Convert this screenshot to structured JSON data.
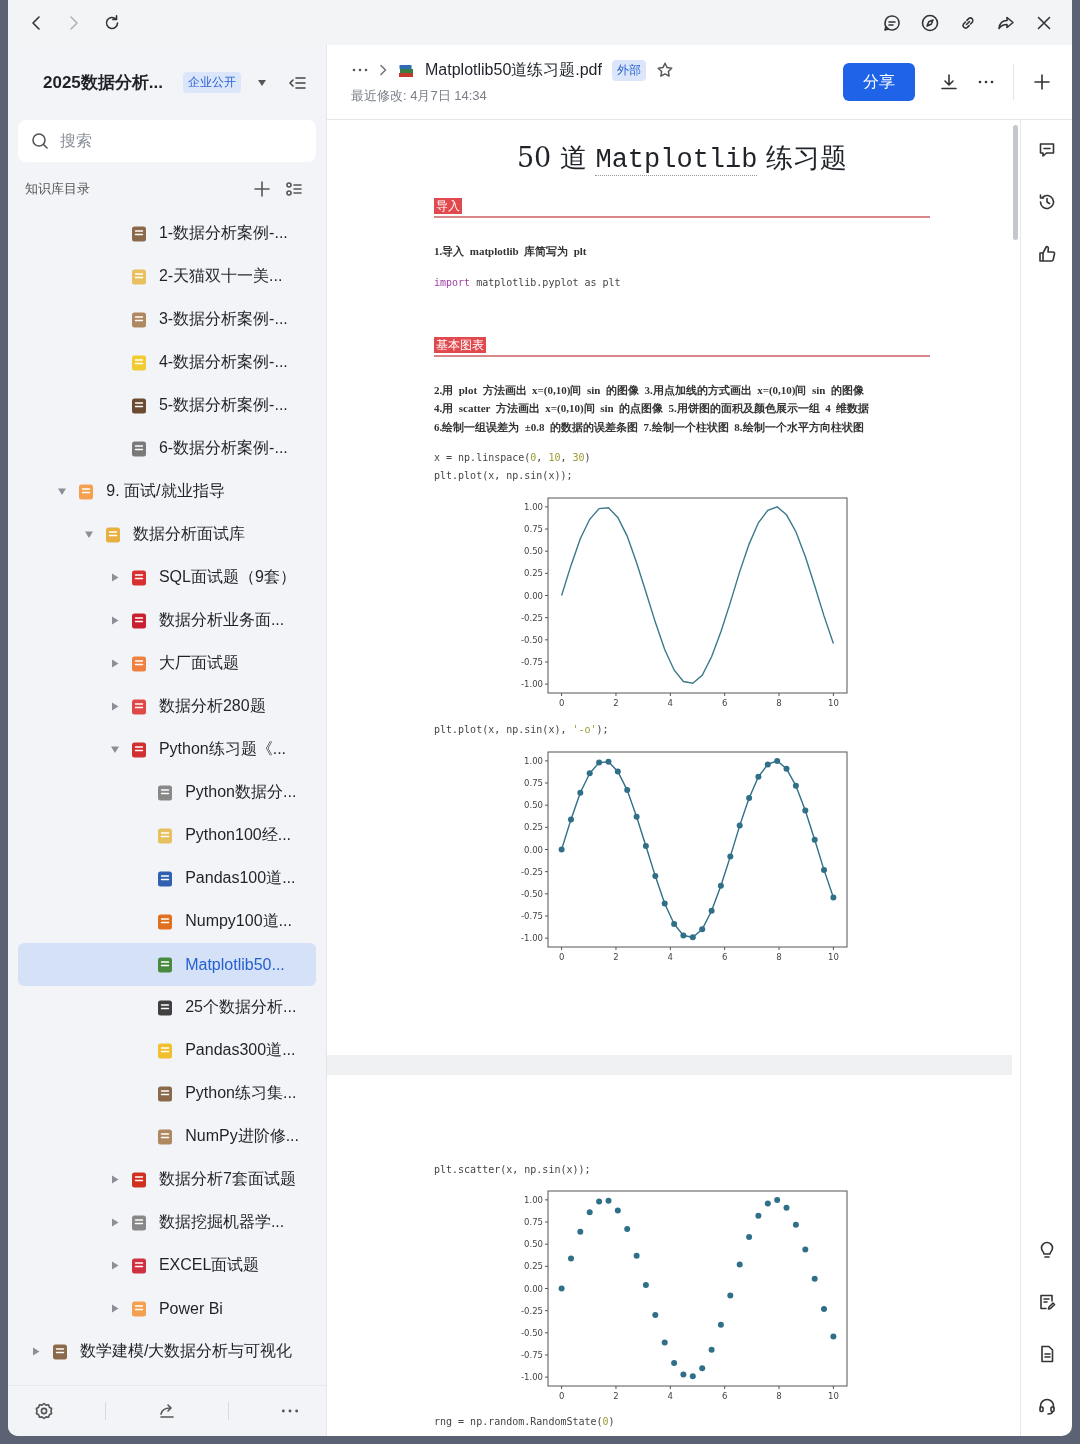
{
  "browser_bar": {
    "nav_buttons": [
      {
        "kind": "back",
        "disabled": false
      },
      {
        "kind": "forward",
        "disabled": true
      },
      {
        "kind": "reload",
        "disabled": false
      }
    ]
  },
  "sidebar": {
    "title": "2025数据分析...",
    "badge": "企业公开",
    "search": {
      "placeholder": "搜索"
    },
    "section_label": "知识库目录",
    "tree": [
      {
        "children": [
          {
            "children": [
              {
                "children": [
                  {
                    "label": "1-数据分析案例-...",
                    "selected": false,
                    "color": "#8a6a4a"
                  },
                  {
                    "label": "2-天猫双十一美...",
                    "selected": false,
                    "color": "#e8c060"
                  },
                  {
                    "label": "3-数据分析案例-...",
                    "selected": false,
                    "color": "#b08860"
                  },
                  {
                    "label": "4-数据分析案例-...",
                    "selected": false,
                    "color": "#f0cc30"
                  },
                  {
                    "label": "5-数据分析案例-...",
                    "selected": false,
                    "color": "#6a4a30"
                  },
                  {
                    "label": "6-数据分析案例-...",
                    "selected": false,
                    "color": "#7a7a7a"
                  }
                ]
              }
            ]
          },
          {
            "label": "9. 面试/就业指导",
            "selected": false,
            "expanded": true,
            "color": "#f5a050",
            "children": [
              {
                "label": "数据分析面试库",
                "selected": false,
                "expanded": true,
                "color": "#e8b040",
                "children": [
                  {
                    "label": "SQL面试题（9套）",
                    "selected": false,
                    "expanded": false,
                    "color": "#d83030"
                  },
                  {
                    "label": "数据分析业务面...",
                    "selected": false,
                    "expanded": false,
                    "color": "#c82030"
                  },
                  {
                    "label": "大厂面试题",
                    "selected": false,
                    "expanded": false,
                    "color": "#f08040"
                  },
                  {
                    "label": "数据分析280题",
                    "selected": false,
                    "expanded": false,
                    "color": "#e04848"
                  },
                  {
                    "label": "Python练习题《...",
                    "selected": false,
                    "expanded": true,
                    "color": "#d03030",
                    "children": [
                      {
                        "label": "Python数据分...",
                        "selected": false,
                        "color": "#888888"
                      },
                      {
                        "label": "Python100经...",
                        "selected": false,
                        "color": "#e8c060"
                      },
                      {
                        "label": "Pandas100道...",
                        "selected": false,
                        "color": "#3060b0"
                      },
                      {
                        "label": "Numpy100道...",
                        "selected": false,
                        "color": "#e07020"
                      },
                      {
                        "label": "Matplotlib50...",
                        "selected": true,
                        "color": "#4a8a40"
                      },
                      {
                        "label": "25个数据分析...",
                        "selected": false,
                        "color": "#404040"
                      },
                      {
                        "label": "Pandas300道...",
                        "selected": false,
                        "color": "#f0c030"
                      },
                      {
                        "label": "Python练习集...",
                        "selected": false,
                        "color": "#8a6a4a"
                      },
                      {
                        "label": "NumPy进阶修...",
                        "selected": false,
                        "color": "#b08860"
                      }
                    ]
                  },
                  {
                    "label": "数据分析7套面试题",
                    "selected": false,
                    "expanded": false,
                    "color": "#d03020"
                  },
                  {
                    "label": "数据挖掘机器学...",
                    "selected": false,
                    "expanded": false,
                    "color": "#888888"
                  },
                  {
                    "label": "EXCEL面试题",
                    "selected": false,
                    "expanded": false,
                    "color": "#d03040"
                  },
                  {
                    "label": "Power Bi",
                    "selected": false,
                    "expanded": false,
                    "color": "#f5a050"
                  }
                ]
              }
            ]
          }
        ]
      },
      {
        "label": "数学建模/大数据分析与可视化",
        "selected": false,
        "expanded": false,
        "color": "#8a6a4a"
      }
    ]
  },
  "document_header": {
    "file_name": "Matplotlib50道练习题.pdf",
    "badge": "外部",
    "modified": "最近修改: 4月7日 14:34",
    "share_button": "分享"
  },
  "document": {
    "pages": [
      {
        "blocks": [
          {
            "kind": "title",
            "segments": [
              {
                "text": "50 道 ",
                "kind": "plain"
              },
              {
                "text": "Matplotlib",
                "kind": "code"
              },
              {
                "text": " 练习题",
                "kind": "plain"
              }
            ]
          },
          {
            "kind": "section",
            "label": "导入"
          },
          {
            "kind": "text",
            "lines": [
              "1.导入  matplotlib  库简写为  plt"
            ]
          },
          {
            "kind": "code",
            "lines": [
              [
                {
                  "text": "import",
                  "kind": "keyword"
                },
                {
                  "text": " matplotlib.pyplot as plt",
                  "kind": "plain"
                }
              ]
            ]
          },
          {
            "kind": "section",
            "label": "基本图表"
          },
          {
            "kind": "text",
            "lines": [
              "2.用  plot  方法画出  x=(0,10)间  sin  的图像  3.用点加线的方式画出  x=(0,10)间  sin  的图像",
              "4.用  scatter  方法画出  x=(0,10)间  sin  的点图像  5.用饼图的面积及颜色展示一组  4  维数据",
              "6.绘制一组误差为  ±0.8  的数据的误差条图  7.绘制一个柱状图  8.绘制一个水平方向柱状图"
            ]
          },
          {
            "kind": "code",
            "lines": [
              [
                {
                  "text": "x = np.linspace(",
                  "kind": "plain"
                },
                {
                  "text": "0",
                  "kind": "number"
                },
                {
                  "text": ", ",
                  "kind": "plain"
                },
                {
                  "text": "10",
                  "kind": "number"
                },
                {
                  "text": ", ",
                  "kind": "plain"
                },
                {
                  "text": "30",
                  "kind": "number"
                },
                {
                  "text": ")",
                  "kind": "plain"
                }
              ],
              [
                {
                  "text": "plt.plot(x, np.sin(x));",
                  "kind": "plain"
                }
              ]
            ]
          },
          {
            "kind": "chart",
            "chart_data": {
              "type": "line",
              "x": [
                0,
                0.345,
                0.69,
                1.034,
                1.379,
                1.724,
                2.069,
                2.414,
                2.759,
                3.103,
                3.448,
                3.793,
                4.138,
                4.483,
                4.828,
                5.172,
                5.517,
                5.862,
                6.207,
                6.552,
                6.897,
                7.241,
                7.586,
                7.931,
                8.276,
                8.621,
                8.966,
                9.31,
                9.655,
                10
              ],
              "series": [
                {
                  "color": "#3a7a8c",
                  "values": [
                    0,
                    0.34,
                    0.64,
                    0.86,
                    0.98,
                    0.99,
                    0.88,
                    0.67,
                    0.37,
                    0.04,
                    -0.3,
                    -0.61,
                    -0.84,
                    -0.97,
                    -0.99,
                    -0.9,
                    -0.69,
                    -0.41,
                    -0.08,
                    0.27,
                    0.58,
                    0.82,
                    0.96,
                    1,
                    0.91,
                    0.72,
                    0.44,
                    0.11,
                    -0.23,
                    -0.54
                  ]
                }
              ],
              "xlim": [
                -0.5,
                10.5
              ],
              "ylim": [
                -1.1,
                1.1
              ],
              "xticks": [
                0,
                2,
                4,
                6,
                8,
                10
              ],
              "yticks": [
                {
                  "value": 1,
                  "label": "1.00"
                },
                {
                  "value": 0.75,
                  "label": "0.75"
                },
                {
                  "value": 0.5,
                  "label": "0.50"
                },
                {
                  "value": 0.25,
                  "label": "0.25"
                },
                {
                  "value": 0,
                  "label": "0.00"
                },
                {
                  "value": -0.25,
                  "label": "-0.25"
                },
                {
                  "value": -0.5,
                  "label": "-0.50"
                },
                {
                  "value": -0.75,
                  "label": "-0.75"
                },
                {
                  "value": -1,
                  "label": "-1.00"
                }
              ]
            }
          },
          {
            "kind": "code",
            "lines": [
              [
                {
                  "text": "plt.plot(x, np.sin(x), ",
                  "kind": "plain"
                },
                {
                  "text": "'-o'",
                  "kind": "string"
                },
                {
                  "text": ");",
                  "kind": "plain"
                }
              ]
            ]
          },
          {
            "kind": "chart",
            "chart_data": {
              "type": "line",
              "x": [
                0,
                0.345,
                0.69,
                1.034,
                1.379,
                1.724,
                2.069,
                2.414,
                2.759,
                3.103,
                3.448,
                3.793,
                4.138,
                4.483,
                4.828,
                5.172,
                5.517,
                5.862,
                6.207,
                6.552,
                6.897,
                7.241,
                7.586,
                7.931,
                8.276,
                8.621,
                8.966,
                9.31,
                9.655,
                10
              ],
              "series": [
                {
                  "color": "#2f6f88",
                  "marker": "o",
                  "values": [
                    0,
                    0.34,
                    0.64,
                    0.86,
                    0.98,
                    0.99,
                    0.88,
                    0.67,
                    0.37,
                    0.04,
                    -0.3,
                    -0.61,
                    -0.84,
                    -0.97,
                    -0.99,
                    -0.9,
                    -0.69,
                    -0.41,
                    -0.08,
                    0.27,
                    0.58,
                    0.82,
                    0.96,
                    1,
                    0.91,
                    0.72,
                    0.44,
                    0.11,
                    -0.23,
                    -0.54
                  ]
                }
              ],
              "xlim": [
                -0.5,
                10.5
              ],
              "ylim": [
                -1.1,
                1.1
              ],
              "xticks": [
                0,
                2,
                4,
                6,
                8,
                10
              ],
              "yticks": [
                {
                  "value": 1,
                  "label": "1.00"
                },
                {
                  "value": 0.75,
                  "label": "0.75"
                },
                {
                  "value": 0.5,
                  "label": "0.50"
                },
                {
                  "value": 0.25,
                  "label": "0.25"
                },
                {
                  "value": 0,
                  "label": "0.00"
                },
                {
                  "value": -0.25,
                  "label": "-0.25"
                },
                {
                  "value": -0.5,
                  "label": "-0.50"
                },
                {
                  "value": -0.75,
                  "label": "-0.75"
                },
                {
                  "value": -1,
                  "label": "-1.00"
                }
              ]
            }
          }
        ]
      },
      {
        "blocks": [
          {
            "kind": "code",
            "lines": [
              [
                {
                  "text": "plt.scatter(x, np.sin(x));",
                  "kind": "plain"
                }
              ]
            ]
          },
          {
            "kind": "chart",
            "chart_data": {
              "type": "scatter",
              "x": [
                0,
                0.345,
                0.69,
                1.034,
                1.379,
                1.724,
                2.069,
                2.414,
                2.759,
                3.103,
                3.448,
                3.793,
                4.138,
                4.483,
                4.828,
                5.172,
                5.517,
                5.862,
                6.207,
                6.552,
                6.897,
                7.241,
                7.586,
                7.931,
                8.276,
                8.621,
                8.966,
                9.31,
                9.655,
                10
              ],
              "series": [
                {
                  "color": "#2f6f88",
                  "values": [
                    0,
                    0.34,
                    0.64,
                    0.86,
                    0.98,
                    0.99,
                    0.88,
                    0.67,
                    0.37,
                    0.04,
                    -0.3,
                    -0.61,
                    -0.84,
                    -0.97,
                    -0.99,
                    -0.9,
                    -0.69,
                    -0.41,
                    -0.08,
                    0.27,
                    0.58,
                    0.82,
                    0.96,
                    1,
                    0.91,
                    0.72,
                    0.44,
                    0.11,
                    -0.23,
                    -0.54
                  ]
                }
              ],
              "xlim": [
                -0.5,
                10.5
              ],
              "ylim": [
                -1.1,
                1.1
              ],
              "xticks": [
                0,
                2,
                4,
                6,
                8,
                10
              ],
              "yticks": [
                {
                  "value": 1,
                  "label": "1.00"
                },
                {
                  "value": 0.75,
                  "label": "0.75"
                },
                {
                  "value": 0.5,
                  "label": "0.50"
                },
                {
                  "value": 0.25,
                  "label": "0.25"
                },
                {
                  "value": 0,
                  "label": "0.00"
                },
                {
                  "value": -0.25,
                  "label": "-0.25"
                },
                {
                  "value": -0.5,
                  "label": "-0.50"
                },
                {
                  "value": -0.75,
                  "label": "-0.75"
                },
                {
                  "value": -1,
                  "label": "-1.00"
                }
              ]
            }
          },
          {
            "kind": "code",
            "lines": [
              [
                {
                  "text": "rng = np.random.RandomState(",
                  "kind": "plain"
                },
                {
                  "text": "0",
                  "kind": "number"
                },
                {
                  "text": ")",
                  "kind": "plain"
                }
              ]
            ]
          }
        ]
      }
    ]
  }
}
